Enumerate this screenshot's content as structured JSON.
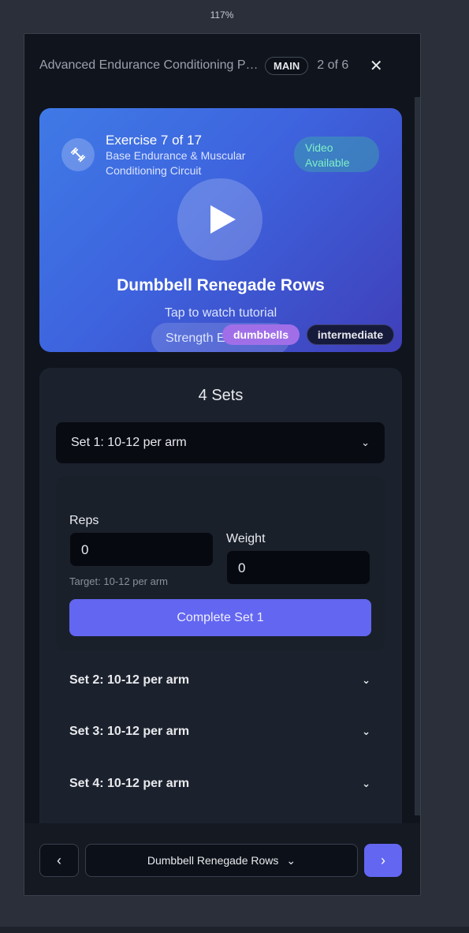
{
  "zoom": "117%",
  "header": {
    "title": "Advanced Endurance Conditioning Program",
    "badge": "MAIN",
    "counter": "2 of 6",
    "close": "✕"
  },
  "exercise": {
    "icon": "dumbbell-icon",
    "number": "Exercise 7 of 17",
    "circuit": "Base Endurance & Muscular Conditioning Circuit",
    "video_badge": "Video Available",
    "name": "Dumbbell Renegade Rows",
    "tap_hint": "Tap to watch tutorial",
    "category": "Strength Exercise",
    "equipment": "dumbbells",
    "level": "intermediate"
  },
  "sets": {
    "title": "4 Sets",
    "items": [
      {
        "label": "Set 1: 10-12 per arm"
      },
      {
        "label": "Set 2: 10-12 per arm"
      },
      {
        "label": "Set 3: 10-12 per arm"
      },
      {
        "label": "Set 4: 10-12 per arm"
      }
    ],
    "active": {
      "reps_label": "Reps",
      "reps_value": "0",
      "reps_hint": "Target: 10-12 per arm",
      "weight_label": "Weight",
      "weight_value": "0",
      "complete_label": "Complete Set 1"
    }
  },
  "footer": {
    "prev": "‹",
    "select_label": "Dumbbell Renegade Rows",
    "next": "›"
  },
  "colors": {
    "accent": "#6366f1",
    "video_badge_text": "#7ef0c6",
    "equipment_pill": "#a06fe8"
  }
}
